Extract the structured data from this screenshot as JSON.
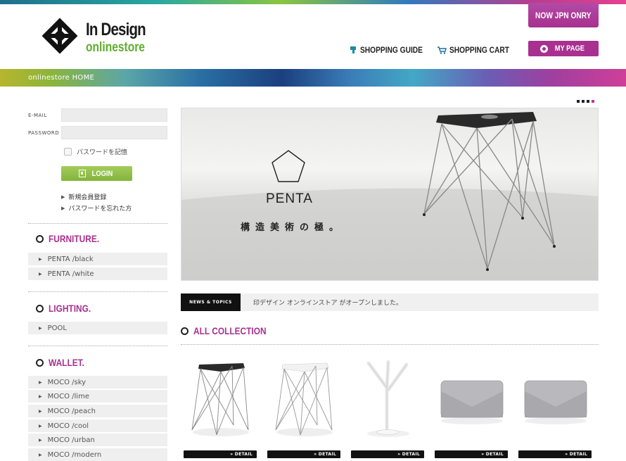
{
  "header": {
    "logo_line1": "In Design",
    "logo_line2": "onlinestore",
    "now_jpn": "NOW JPN ONRY",
    "shopping_guide": "SHOPPING GUIDE",
    "shopping_cart": "SHOPPING CART",
    "my_page": "MY PAGE"
  },
  "breadcrumb": {
    "home": "onlinestore HOME"
  },
  "login": {
    "email_label": "E-MAIL",
    "password_label": "PASSWORD",
    "remember_label": "パスワードを記憶",
    "login_button": "LOGIN",
    "register_link": "新規会員登録",
    "forgot_link": "パスワードを忘れた方"
  },
  "categories": [
    {
      "title": "FURNITURE.",
      "items": [
        "PENTA /black",
        "PENTA /white"
      ]
    },
    {
      "title": "LIGHTING.",
      "items": [
        "POOL"
      ]
    },
    {
      "title": "WALLET.",
      "items": [
        "MOCO /sky",
        "MOCO /lime",
        "MOCO /peach",
        "MOCO /cool",
        "MOCO /urban",
        "MOCO /modern"
      ]
    }
  ],
  "hero": {
    "brand": "PENTA",
    "tagline": "構造美術の極。",
    "slide_count": 4,
    "active_slide": 4
  },
  "news": {
    "tag": "NEWS & TOPICS",
    "text": "印デザイン オンラインストア がオープンしました。"
  },
  "collection": {
    "title": "ALL COLLECTION",
    "detail_label": "» DETAIL",
    "products": [
      {
        "icon": "black-stool"
      },
      {
        "icon": "white-stool"
      },
      {
        "icon": "branch-lamp"
      },
      {
        "icon": "felt-wallet"
      },
      {
        "icon": "felt-wallet"
      }
    ]
  },
  "colors": {
    "accent_magenta": "#a8308f",
    "accent_green": "#82b43b"
  }
}
